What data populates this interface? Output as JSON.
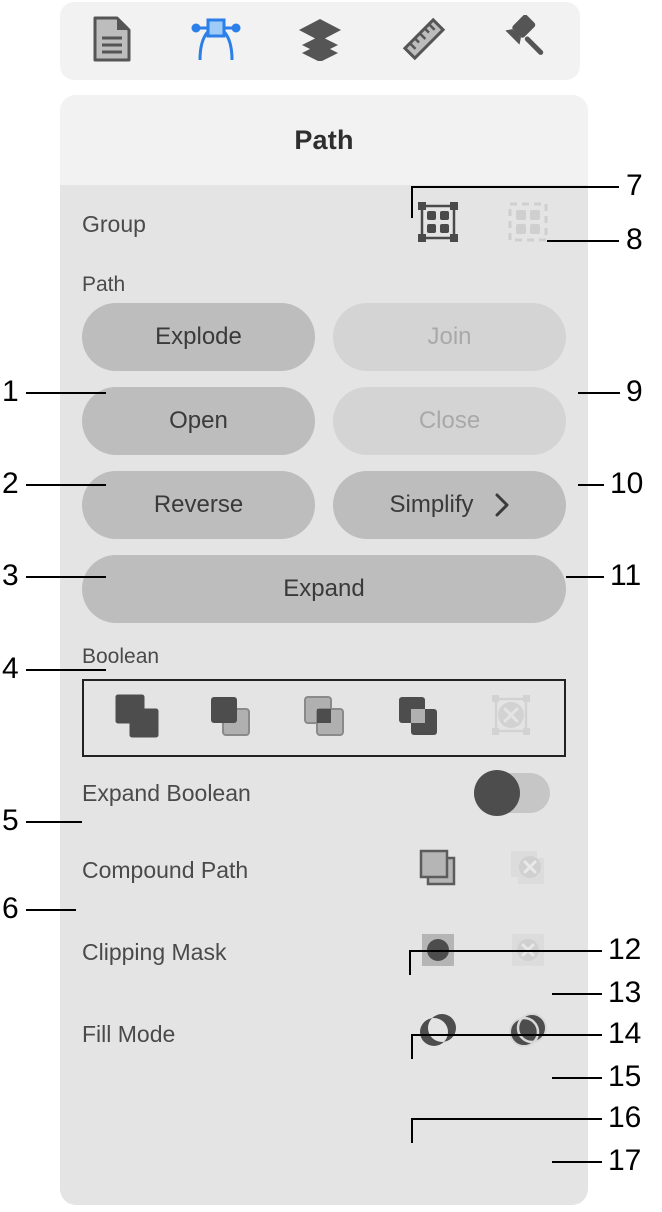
{
  "toolbar": {
    "tabs": [
      {
        "icon": "document-icon",
        "name": "tab-document",
        "active": false
      },
      {
        "icon": "node-path-icon",
        "name": "tab-path",
        "active": true
      },
      {
        "icon": "layers-icon",
        "name": "tab-layers",
        "active": false
      },
      {
        "icon": "ruler-icon",
        "name": "tab-ruler",
        "active": false
      },
      {
        "icon": "brush-icon",
        "name": "tab-style",
        "active": false
      }
    ],
    "accent_color": "#2a7fe8"
  },
  "panel": {
    "title": "Path",
    "group": {
      "label": "Group",
      "buttons": [
        {
          "label": "",
          "icon": "group-icon",
          "enabled": true
        },
        {
          "label": "",
          "icon": "ungroup-icon",
          "enabled": false
        }
      ]
    },
    "path_section": {
      "label": "Path",
      "buttons": [
        {
          "label": "Explode",
          "enabled": true
        },
        {
          "label": "Join",
          "enabled": false
        },
        {
          "label": "Open",
          "enabled": true
        },
        {
          "label": "Close",
          "enabled": false
        },
        {
          "label": "Reverse",
          "enabled": true
        },
        {
          "label": "Simplify",
          "enabled": true,
          "chevron": "›"
        },
        {
          "label": "Expand",
          "enabled": true
        }
      ]
    },
    "boolean_section": {
      "label": "Boolean",
      "operations": [
        {
          "name": "boolean-union-icon",
          "enabled": true
        },
        {
          "name": "boolean-subtract-icon",
          "enabled": true
        },
        {
          "name": "boolean-intersect-icon",
          "enabled": true
        },
        {
          "name": "boolean-difference-icon",
          "enabled": true
        },
        {
          "name": "boolean-release-icon",
          "enabled": false
        }
      ]
    },
    "expand_boolean": {
      "label": "Expand Boolean",
      "value": "off"
    },
    "compound_path": {
      "label": "Compound Path",
      "make": {
        "icon": "compound-make-icon",
        "enabled": true
      },
      "release": {
        "icon": "compound-release-icon",
        "enabled": false
      }
    },
    "clipping_mask": {
      "label": "Clipping Mask",
      "make": {
        "icon": "clip-make-icon",
        "enabled": true
      },
      "release": {
        "icon": "clip-release-icon",
        "enabled": false
      }
    },
    "fill_mode": {
      "label": "Fill Mode",
      "even_odd": {
        "icon": "fill-even-odd-icon",
        "enabled": true
      },
      "non_zero": {
        "icon": "fill-non-zero-icon",
        "enabled": true
      }
    }
  },
  "callouts": [
    {
      "n": "1",
      "target": "explode-button"
    },
    {
      "n": "2",
      "target": "open-button"
    },
    {
      "n": "3",
      "target": "reverse-button"
    },
    {
      "n": "4",
      "target": "expand-button"
    },
    {
      "n": "5",
      "target": "boolean-operations-box"
    },
    {
      "n": "6",
      "target": "expand-boolean-row"
    },
    {
      "n": "7",
      "target": "group-button"
    },
    {
      "n": "8",
      "target": "ungroup-button"
    },
    {
      "n": "9",
      "target": "join-button"
    },
    {
      "n": "10",
      "target": "close-button"
    },
    {
      "n": "11",
      "target": "simplify-button"
    },
    {
      "n": "12",
      "target": "compound-path-make-button"
    },
    {
      "n": "13",
      "target": "compound-path-release-button"
    },
    {
      "n": "14",
      "target": "clipping-mask-make-button"
    },
    {
      "n": "15",
      "target": "clipping-mask-release-button"
    },
    {
      "n": "16",
      "target": "fill-mode-even-odd-button"
    },
    {
      "n": "17",
      "target": "fill-mode-non-zero-button"
    }
  ]
}
